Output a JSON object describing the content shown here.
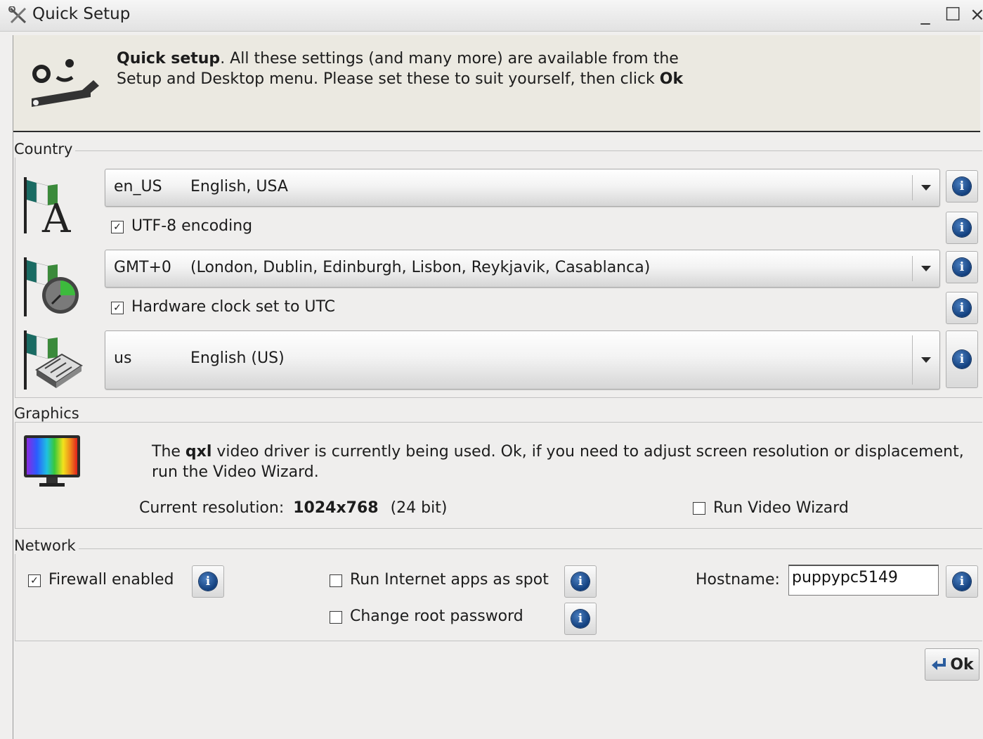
{
  "window": {
    "title": "Quick Setup",
    "minimize_glyph": "_",
    "maximize_glyph": "☐",
    "close_glyph": "×"
  },
  "header": {
    "title_bold": "Quick setup",
    "text_part1": ". All these settings (and many more) are available from the Setup and Desktop menu. Please set these to suit yourself, then click ",
    "ok_word": "Ok",
    "icon": "setup-wrench-icon"
  },
  "country": {
    "label": "Country",
    "locale": {
      "code": "en_US",
      "name": "English, USA"
    },
    "utf8": {
      "label": "UTF-8 encoding",
      "checked": true
    },
    "timezone": {
      "code": "GMT+0",
      "name": "(London, Dublin, Edinburgh, Lisbon, Reykjavik, Casablanca)"
    },
    "hwclock": {
      "label": "Hardware clock set to UTC",
      "checked": true
    },
    "keyboard": {
      "code": "us",
      "name": "English (US)"
    }
  },
  "graphics": {
    "label": "Graphics",
    "text_pre": "The ",
    "driver": "qxl",
    "text_post": " video driver is currently being used. Ok, if you need to adjust screen resolution or displacement, run the Video Wizard.",
    "resolution_label": "Current resolution:",
    "resolution_value": "1024x768",
    "depth": "(24 bit)",
    "run_wizard": {
      "label": "Run Video Wizard",
      "checked": false
    }
  },
  "network": {
    "label": "Network",
    "firewall": {
      "label": "Firewall enabled",
      "checked": true
    },
    "spot": {
      "label": "Run Internet apps as spot",
      "checked": false
    },
    "root_password": {
      "label": "Change root password",
      "checked": false
    },
    "hostname_label": "Hostname:",
    "hostname_value": "puppypc5149"
  },
  "info_glyph": "i",
  "check_glyph": "✓",
  "ok_button": {
    "label": "Ok",
    "icon": "enter-arrow-icon"
  },
  "colors": {
    "info_blue": "#1f5aa3",
    "header_bg": "#ebe9e1",
    "window_bg": "#efeeed"
  }
}
